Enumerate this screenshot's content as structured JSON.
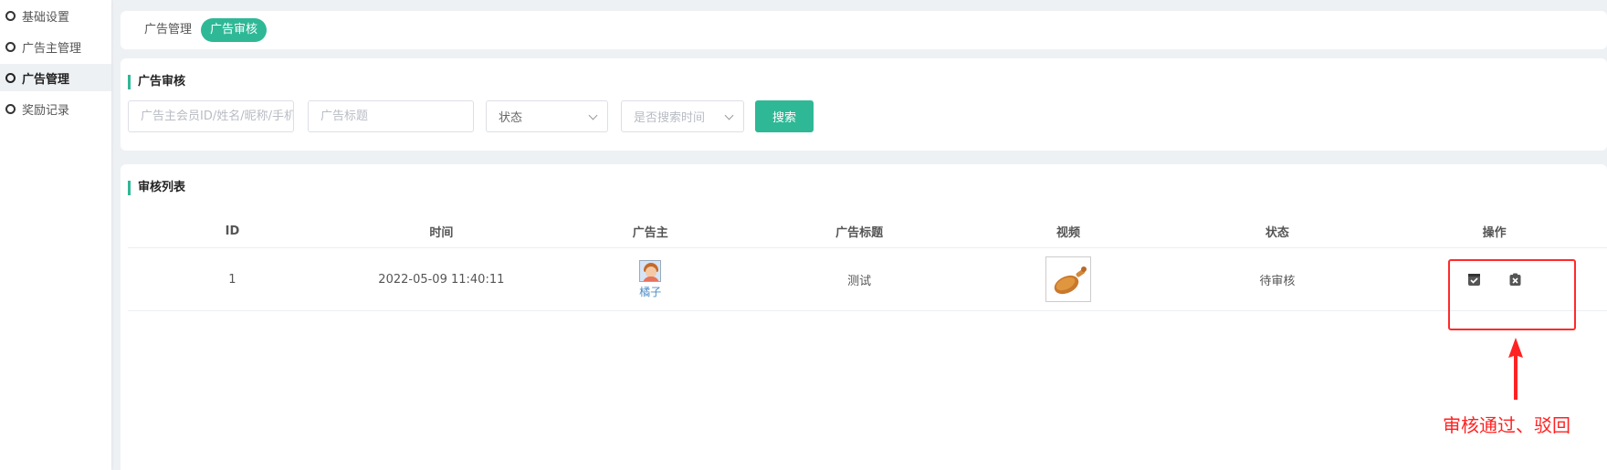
{
  "sidebar": {
    "items": [
      {
        "label": "基础设置",
        "active": false
      },
      {
        "label": "广告主管理",
        "active": false
      },
      {
        "label": "广告管理",
        "active": true
      },
      {
        "label": "奖励记录",
        "active": false
      }
    ]
  },
  "tabs": [
    {
      "label": "广告管理",
      "active": false
    },
    {
      "label": "广告审核",
      "active": true
    }
  ],
  "search": {
    "title": "广告审核",
    "keyword_placeholder": "广告主会员ID/姓名/昵称/手机号",
    "ad_title_placeholder": "广告标题",
    "status_select": "状态",
    "time_select": "是否搜索时间",
    "search_button": "搜索"
  },
  "list": {
    "title": "审核列表",
    "columns": [
      "ID",
      "时间",
      "广告主",
      "广告标题",
      "视频",
      "状态",
      "操作"
    ],
    "rows": [
      {
        "id": "1",
        "time": "2022-05-09 11:40:11",
        "advertiser": "橘子",
        "ad_title": "测试",
        "video_icon": "fried-chicken-thumbnail",
        "status": "待审核",
        "actions": [
          "approve-icon",
          "reject-icon"
        ]
      }
    ]
  },
  "annotation": {
    "text": "审核通过、驳回",
    "color": "#ff2222"
  },
  "colors": {
    "accent": "#2fb896",
    "background": "#eef1f4"
  }
}
